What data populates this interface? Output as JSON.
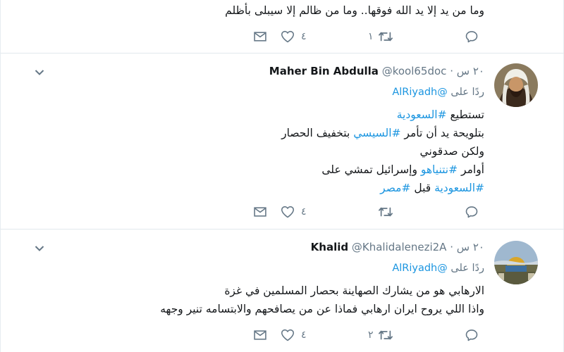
{
  "tweets": [
    {
      "lines": [
        [
          {
            "t": "text",
            "v": "وما من يد إلا يد الله فوقها.. وما من ظالم إلا سيبلى بأظلم"
          }
        ]
      ],
      "actions": {
        "reply": "",
        "retweet": "١",
        "like": "٤",
        "dm": ""
      }
    },
    {
      "name": "Maher Bin Abdulla",
      "handle": "@kool65doc",
      "dot": "·",
      "time": "٢٠ س",
      "reply_label": "ردًا على",
      "reply_to": "@AlRiyadh",
      "lines": [
        [
          {
            "t": "text",
            "v": "تستطيع "
          },
          {
            "t": "tag",
            "v": "#السعودية"
          }
        ],
        [
          {
            "t": "text",
            "v": "بتلويحة يد أن تأمر "
          },
          {
            "t": "tag",
            "v": "#السيسي"
          },
          {
            "t": "text",
            "v": " بتخفيف الحصار"
          }
        ],
        [
          {
            "t": "text",
            "v": "ولكن صدقوني"
          }
        ],
        [
          {
            "t": "text",
            "v": "أوامر "
          },
          {
            "t": "tag",
            "v": "#نتنياهو"
          },
          {
            "t": "text",
            "v": " وإسرائيل تمشي على"
          }
        ],
        [
          {
            "t": "tag",
            "v": "#السعودية"
          },
          {
            "t": "text",
            "v": " قبل "
          },
          {
            "t": "tag",
            "v": "#مصر"
          }
        ]
      ],
      "actions": {
        "reply": "",
        "retweet": "",
        "like": "٤",
        "dm": ""
      }
    },
    {
      "name": "Khalid",
      "handle": "@Khalidalenezi2A",
      "dot": "·",
      "time": "٢٠ س",
      "reply_label": "ردًا على",
      "reply_to": "@AlRiyadh",
      "lines": [
        [
          {
            "t": "text",
            "v": "الارهابي هو من يشارك الصهاينة بحصار المسلمين في غزة"
          }
        ],
        [
          {
            "t": "text",
            "v": "واذا اللي يروح ايران ارهابي فماذا عن من يصافحهم والابتسامه تنير وجهه"
          }
        ]
      ],
      "actions": {
        "reply": "",
        "retweet": "٢",
        "like": "٤",
        "dm": ""
      }
    }
  ],
  "colors": {
    "link": "#1b95e0",
    "muted": "#657786",
    "text": "#14171a",
    "divider": "#e1e8ed"
  },
  "icons": {
    "reply": "reply-icon",
    "retweet": "retweet-icon",
    "like": "heart-icon",
    "dm": "envelope-icon",
    "menu": "chevron-down-icon"
  }
}
